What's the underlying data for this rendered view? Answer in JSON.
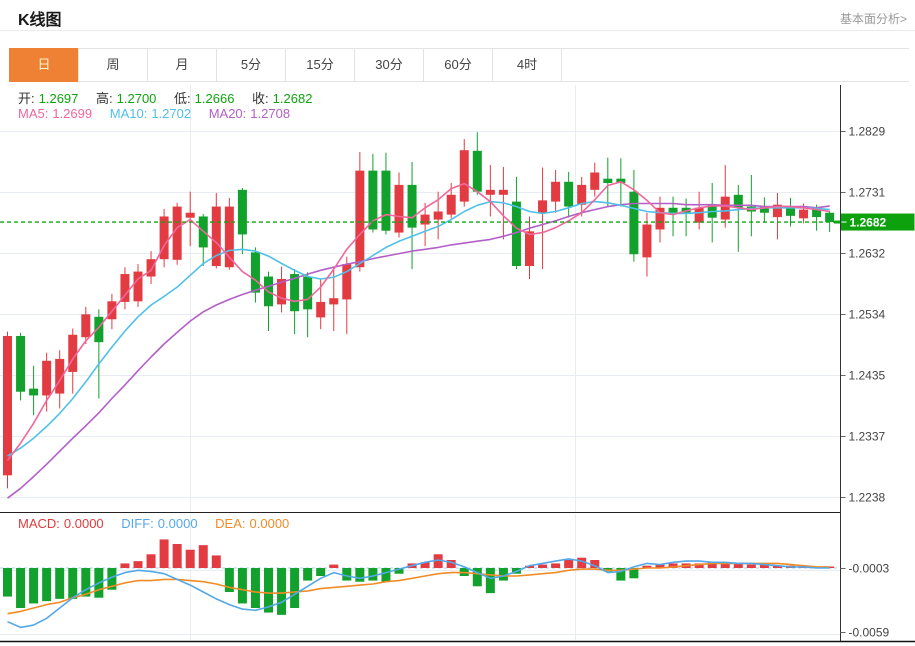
{
  "header": {
    "title": "K线图",
    "link": "基本面分析>"
  },
  "tabs": {
    "items": [
      "日",
      "周",
      "月",
      "5分",
      "15分",
      "30分",
      "60分",
      "4时"
    ],
    "active": "日"
  },
  "ohlc": {
    "open_label": "开:",
    "open": "1.2697",
    "high_label": "高:",
    "high": "1.2700",
    "low_label": "低:",
    "low": "1.2666",
    "close_label": "收:",
    "close": "1.2682"
  },
  "ma": {
    "ma5_label": "MA5:",
    "ma5": "1.2699",
    "ma10_label": "MA10:",
    "ma10": "1.2702",
    "ma20_label": "MA20:",
    "ma20": "1.2708"
  },
  "macd_panel": {
    "macd_label": "MACD:",
    "macd": "0.0000",
    "diff_label": "DIFF:",
    "diff": "0.0000",
    "dea_label": "DEA:",
    "dea": "0.0000"
  },
  "colors": {
    "up": "#e23b41",
    "down": "#12a12c",
    "ma5": "#f0679b",
    "ma10": "#4fc0e8",
    "ma20": "#b35fc8",
    "diff_line": "#54a8e8",
    "dea_line": "#f08c28",
    "price_line": "#0da810",
    "price_tag_bg": "#0da10d",
    "price_tag_text": "#ffffff",
    "grid": "#e7edf3",
    "axis": "#333333",
    "tick_text": "#444444",
    "tab_active_bg": "#ee8133"
  },
  "chart_data": {
    "type": "candlestick+macd",
    "title": "K线图",
    "legend": [
      "MA5",
      "MA10",
      "MA20",
      "MACD",
      "DIFF",
      "DEA"
    ],
    "price_axis": {
      "ticks": [
        1.2829,
        1.2731,
        1.2632,
        1.2534,
        1.2435,
        1.2337,
        1.2238
      ],
      "range": [
        1.2238,
        1.2829
      ],
      "current_price": 1.2682
    },
    "macd_axis": {
      "ticks": [
        -0.0003,
        -0.0059
      ],
      "baseline": -0.0003
    },
    "grid": "on",
    "candles_ohlc": [
      [
        1.2273,
        1.2505,
        1.2252,
        1.2498
      ],
      [
        1.2498,
        1.2503,
        1.2394,
        1.2408
      ],
      [
        1.2413,
        1.245,
        1.237,
        1.2402
      ],
      [
        1.2402,
        1.2471,
        1.2376,
        1.2458
      ],
      [
        1.2405,
        1.2475,
        1.2381,
        1.2461
      ],
      [
        1.244,
        1.251,
        1.2405,
        1.25
      ],
      [
        1.2496,
        1.2545,
        1.2485,
        1.2533
      ],
      [
        1.2529,
        1.2541,
        1.2397,
        1.2488
      ],
      [
        1.2525,
        1.2566,
        1.2509,
        1.2554
      ],
      [
        1.2553,
        1.2609,
        1.2541,
        1.2598
      ],
      [
        1.2554,
        1.2614,
        1.2545,
        1.2602
      ],
      [
        1.2594,
        1.2635,
        1.2582,
        1.2622
      ],
      [
        1.2622,
        1.2703,
        1.2609,
        1.2691
      ],
      [
        1.2621,
        1.2713,
        1.2613,
        1.2707
      ],
      [
        1.2689,
        1.2731,
        1.2643,
        1.2697
      ],
      [
        1.2691,
        1.2695,
        1.2611,
        1.2641
      ],
      [
        1.2611,
        1.2729,
        1.2607,
        1.2707
      ],
      [
        1.2609,
        1.2721,
        1.2605,
        1.2707
      ],
      [
        1.2734,
        1.2737,
        1.263,
        1.2662
      ],
      [
        1.2633,
        1.2641,
        1.2552,
        1.2568
      ],
      [
        1.2594,
        1.2602,
        1.2506,
        1.2546
      ],
      [
        1.2549,
        1.261,
        1.2536,
        1.259
      ],
      [
        1.2598,
        1.2606,
        1.2501,
        1.2538
      ],
      [
        1.2594,
        1.2601,
        1.2496,
        1.2541
      ],
      [
        1.2528,
        1.259,
        1.2509,
        1.2553
      ],
      [
        1.2549,
        1.261,
        1.2506,
        1.2559
      ],
      [
        1.2557,
        1.2626,
        1.2501,
        1.2614
      ],
      [
        1.2609,
        1.2795,
        1.2602,
        1.2765
      ],
      [
        1.2765,
        1.2792,
        1.2665,
        1.267
      ],
      [
        1.2765,
        1.2794,
        1.2662,
        1.2668
      ],
      [
        1.2665,
        1.2762,
        1.2657,
        1.2742
      ],
      [
        1.2742,
        1.2779,
        1.2606,
        1.2673
      ],
      [
        1.2678,
        1.2713,
        1.2643,
        1.2694
      ],
      [
        1.2686,
        1.2731,
        1.2654,
        1.2699
      ],
      [
        1.2694,
        1.2745,
        1.2688,
        1.2726
      ],
      [
        1.2715,
        1.2816,
        1.2707,
        1.2798
      ],
      [
        1.2797,
        1.2827,
        1.2726,
        1.2731
      ],
      [
        1.2726,
        1.2774,
        1.2691,
        1.2734
      ],
      [
        1.2726,
        1.2771,
        1.2654,
        1.2734
      ],
      [
        1.2715,
        1.2755,
        1.2606,
        1.2611
      ],
      [
        1.2611,
        1.2691,
        1.259,
        1.2667
      ],
      [
        1.2697,
        1.277,
        1.2606,
        1.2717
      ],
      [
        1.2715,
        1.2766,
        1.2697,
        1.2747
      ],
      [
        1.2747,
        1.2763,
        1.2689,
        1.2707
      ],
      [
        1.271,
        1.2755,
        1.2691,
        1.2742
      ],
      [
        1.2734,
        1.2778,
        1.2723,
        1.2762
      ],
      [
        1.2752,
        1.2786,
        1.2707,
        1.2745
      ],
      [
        1.2752,
        1.2785,
        1.2707,
        1.2745
      ],
      [
        1.2731,
        1.2766,
        1.2618,
        1.263
      ],
      [
        1.2625,
        1.2697,
        1.2594,
        1.2678
      ],
      [
        1.267,
        1.2723,
        1.2649,
        1.2705
      ],
      [
        1.2705,
        1.2723,
        1.2659,
        1.2697
      ],
      [
        1.2705,
        1.272,
        1.2659,
        1.2697
      ],
      [
        1.2681,
        1.2731,
        1.267,
        1.2705
      ],
      [
        1.271,
        1.2745,
        1.2649,
        1.2689
      ],
      [
        1.2686,
        1.2774,
        1.2673,
        1.2723
      ],
      [
        1.2726,
        1.2742,
        1.2634,
        1.2705
      ],
      [
        1.2707,
        1.2758,
        1.2659,
        1.2699
      ],
      [
        1.2707,
        1.2722,
        1.2681,
        1.2697
      ],
      [
        1.269,
        1.2729,
        1.2654,
        1.271
      ],
      [
        1.2705,
        1.2721,
        1.2675,
        1.2692
      ],
      [
        1.2688,
        1.2712,
        1.268,
        1.2702
      ],
      [
        1.2702,
        1.271,
        1.2668,
        1.269
      ],
      [
        1.2697,
        1.27,
        1.2666,
        1.2682
      ]
    ],
    "ma5_series": [
      1.2297,
      1.2325,
      1.2357,
      1.2394,
      1.2426,
      1.2461,
      1.249,
      1.2512,
      1.2538,
      1.2564,
      1.259,
      1.2604,
      1.2644,
      1.2673,
      1.2686,
      1.2667,
      1.2649,
      1.2625,
      1.2602,
      1.2588,
      1.2569,
      1.2559,
      1.2554,
      1.2557,
      1.2577,
      1.2606,
      1.2638,
      1.2662,
      1.2684,
      1.2694,
      1.2691,
      1.2689,
      1.2705,
      1.2718,
      1.2736,
      1.2744,
      1.2731,
      1.2715,
      1.2692,
      1.2672,
      1.2662,
      1.2665,
      1.2673,
      1.2684,
      1.2697,
      1.2718,
      1.2741,
      1.2747,
      1.2734,
      1.2717,
      1.2697,
      1.2694,
      1.27,
      1.2705,
      1.2708,
      1.2708,
      1.2705,
      1.2702,
      1.2705,
      1.2707,
      1.2707,
      1.2705,
      1.2702,
      1.2699
    ],
    "ma10_series": [
      1.2304,
      1.2317,
      1.2333,
      1.2352,
      1.2373,
      1.2397,
      1.2424,
      1.2453,
      1.248,
      1.2506,
      1.2529,
      1.2548,
      1.2562,
      1.2577,
      1.2596,
      1.2615,
      1.2628,
      1.2636,
      1.2638,
      1.2635,
      1.2627,
      1.2615,
      1.2604,
      1.2594,
      1.259,
      1.2593,
      1.2602,
      1.2615,
      1.2628,
      1.2641,
      1.2651,
      1.2659,
      1.2667,
      1.2675,
      1.2686,
      1.2699,
      1.2709,
      1.2715,
      1.2713,
      1.2707,
      1.2699,
      1.2696,
      1.2699,
      1.2705,
      1.2712,
      1.2715,
      1.2713,
      1.2709,
      1.2704,
      1.2699,
      1.2697,
      1.2696,
      1.2696,
      1.2697,
      1.2699,
      1.27,
      1.2702,
      1.2704,
      1.2705,
      1.2705,
      1.2705,
      1.2705,
      1.2704,
      1.2702
    ],
    "ma20_series": [
      1.2236,
      1.2252,
      1.2271,
      1.2291,
      1.2312,
      1.2333,
      1.2353,
      1.2374,
      1.2397,
      1.2419,
      1.2442,
      1.2464,
      1.2485,
      1.2504,
      1.2522,
      1.2537,
      1.2548,
      1.2557,
      1.2565,
      1.2572,
      1.2578,
      1.2585,
      1.2591,
      1.2598,
      1.2604,
      1.2609,
      1.2614,
      1.2618,
      1.2623,
      1.2627,
      1.2631,
      1.2635,
      1.2638,
      1.2641,
      1.2645,
      1.2648,
      1.2651,
      1.2654,
      1.2659,
      1.2665,
      1.2672,
      1.2678,
      1.2684,
      1.2691,
      1.2697,
      1.2702,
      1.2707,
      1.271,
      1.2712,
      1.2712,
      1.2712,
      1.2712,
      1.271,
      1.271,
      1.271,
      1.2709,
      1.2709,
      1.2709,
      1.2707,
      1.2707,
      1.2707,
      1.2707,
      1.2705,
      1.2708
    ],
    "macd_hist": [
      -0.0025,
      -0.0035,
      -0.0031,
      -0.0029,
      -0.0027,
      -0.0027,
      -0.0025,
      -0.0026,
      -0.0019,
      0.0004,
      0.0006,
      0.0012,
      0.0025,
      0.0021,
      0.0016,
      0.002,
      0.0011,
      -0.0021,
      -0.0031,
      -0.0035,
      -0.0039,
      -0.0041,
      -0.0035,
      -0.0011,
      -0.0007,
      0.0003,
      -0.0011,
      -0.0012,
      -0.0011,
      -0.0012,
      -0.0005,
      0.0004,
      0.0005,
      0.0012,
      0.0007,
      -0.0007,
      -0.0016,
      -0.0022,
      -0.0011,
      -0.0005,
      0.0002,
      0.0003,
      0.0004,
      0.0007,
      0.0009,
      0.0007,
      -0.0003,
      -0.0011,
      -0.0009,
      0.0002,
      0.0003,
      0.0004,
      0.0004,
      0.0004,
      0.0005,
      0.0004,
      0.0004,
      0.0003,
      0.0003,
      0.0002,
      0.0002,
      0.0002,
      0.0001,
      0.0001
    ],
    "diff_series": [
      -0.005,
      -0.0055,
      -0.0053,
      -0.0047,
      -0.0038,
      -0.0029,
      -0.0022,
      -0.0016,
      -0.0011,
      -0.0007,
      -0.0005,
      -0.0006,
      -0.0008,
      -0.0013,
      -0.0018,
      -0.0024,
      -0.003,
      -0.0035,
      -0.0039,
      -0.004,
      -0.0037,
      -0.0033,
      -0.0026,
      -0.0019,
      -0.0012,
      -0.0007,
      -0.001,
      -0.0012,
      -0.001,
      -0.0007,
      -0.0004,
      -0.0001,
      0.0002,
      0.0004,
      0.0002,
      -0.0002,
      -0.0007,
      -0.0012,
      -0.001,
      -0.0006,
      -0.0001,
      0.0001,
      0.0003,
      0.0005,
      0.0003,
      -0.0001,
      -0.0007,
      -0.0006,
      -0.0002,
      0.0001,
      0.0,
      0.0002,
      0.0003,
      0.0003,
      0.0002,
      0.0002,
      0.0001,
      0.0001,
      0.0,
      -0.0001,
      -0.0002,
      -0.0002,
      -0.0003,
      -0.0003
    ],
    "dea_series": [
      -0.0043,
      -0.0041,
      -0.0038,
      -0.0035,
      -0.0033,
      -0.0029,
      -0.0026,
      -0.0022,
      -0.0019,
      -0.0016,
      -0.0014,
      -0.0014,
      -0.0013,
      -0.0013,
      -0.0014,
      -0.0015,
      -0.0017,
      -0.002,
      -0.0022,
      -0.0024,
      -0.0025,
      -0.0025,
      -0.0024,
      -0.0023,
      -0.0021,
      -0.002,
      -0.0019,
      -0.0018,
      -0.0017,
      -0.0015,
      -0.0014,
      -0.0012,
      -0.001,
      -0.0008,
      -0.0007,
      -0.0007,
      -0.0008,
      -0.0009,
      -0.001,
      -0.001,
      -0.0009,
      -0.0008,
      -0.0007,
      -0.0005,
      -0.0004,
      -0.0004,
      -0.0005,
      -0.0005,
      -0.0004,
      -0.0003,
      -0.0003,
      -0.0002,
      -0.0001,
      0.0,
      0.0001,
      0.0001,
      0.0001,
      0.0001,
      0.0001,
      0.0001,
      0.0,
      -0.0001,
      -0.0002,
      -0.0002
    ]
  }
}
